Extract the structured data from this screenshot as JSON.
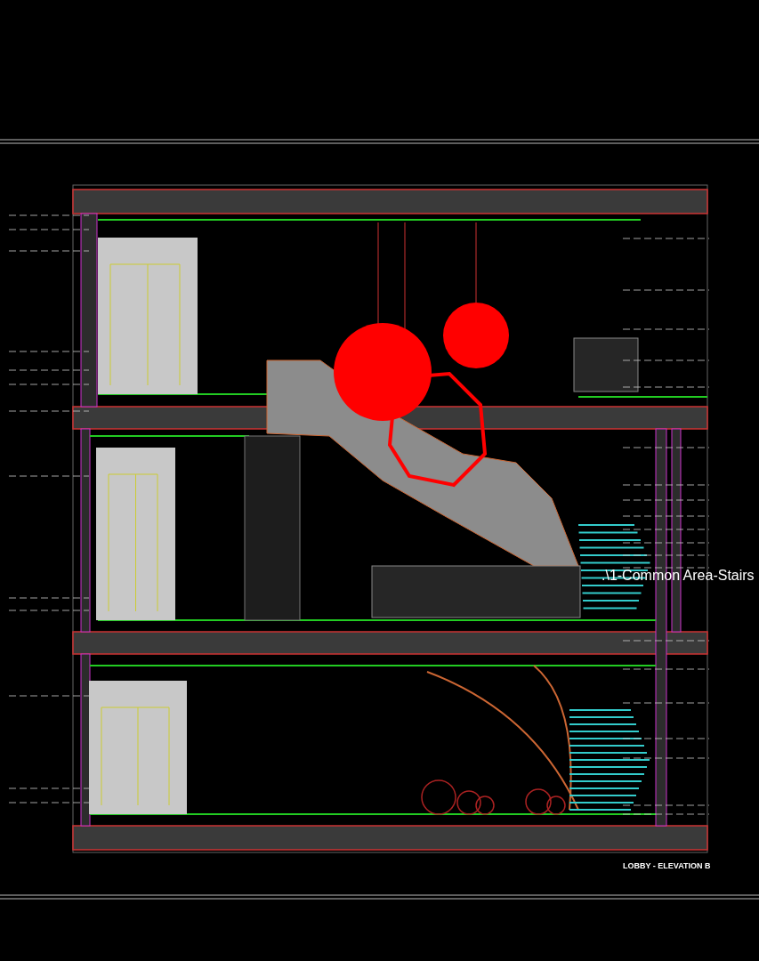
{
  "drawing_title": ".\\1-Common Area-Stairs",
  "sheet_caption": "LOBBY - ELEVATION B"
}
